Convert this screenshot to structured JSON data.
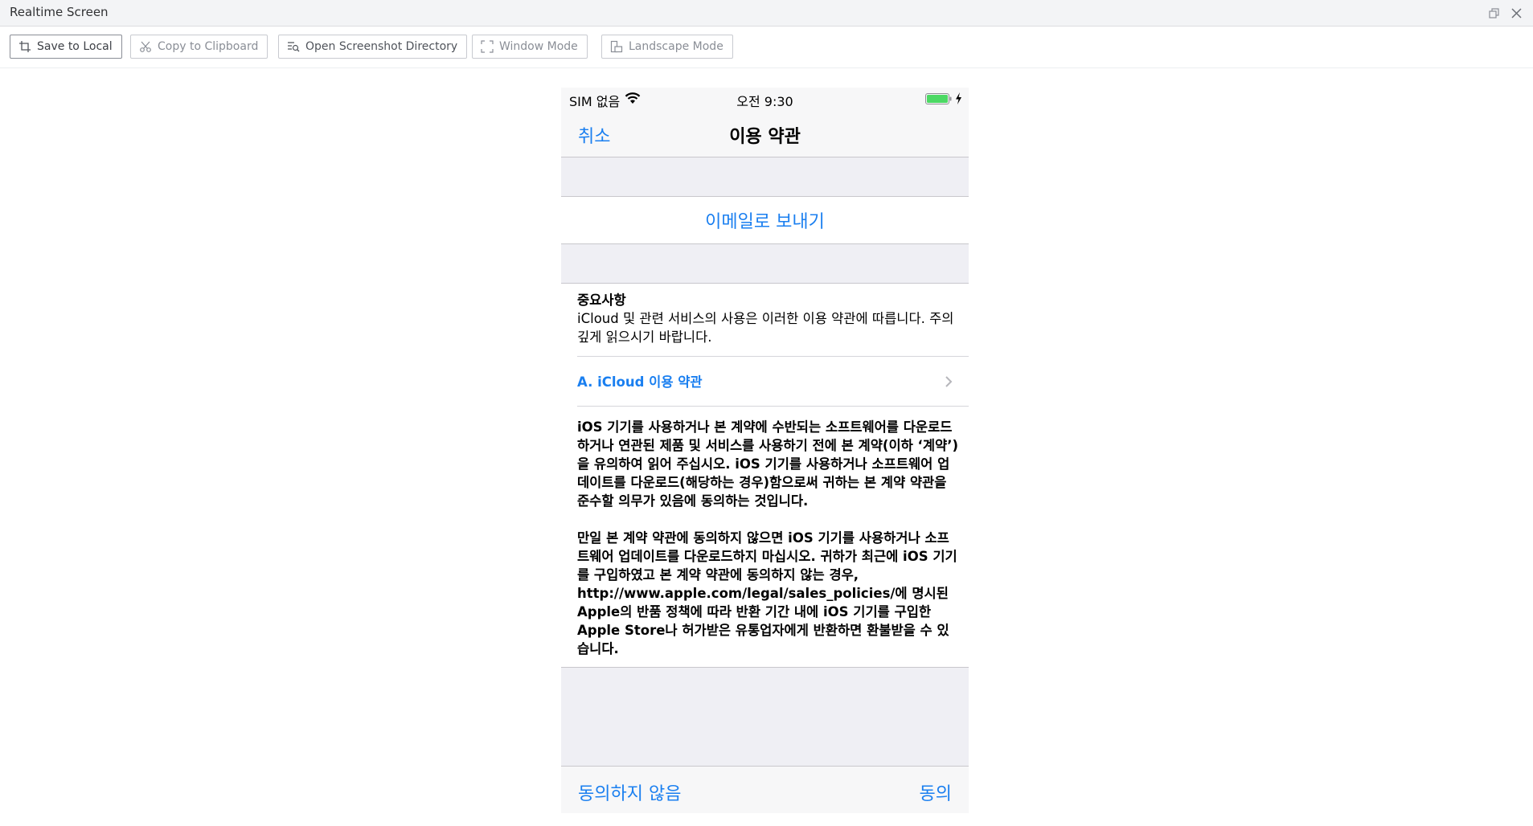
{
  "window": {
    "title": "Realtime Screen"
  },
  "toolbar": {
    "buttons": [
      {
        "label": "Save to Local",
        "icon": "crop-icon"
      },
      {
        "label": "Copy to Clipboard",
        "icon": "scissors-icon"
      },
      {
        "label": "Open Screenshot Directory",
        "icon": "folder-search-icon"
      },
      {
        "label": "Window Mode",
        "icon": "fullscreen-icon"
      },
      {
        "label": "Landscape Mode",
        "icon": "rotate-icon"
      }
    ]
  },
  "phone": {
    "status": {
      "carrier": "SIM 없음",
      "time": "오전 9:30",
      "battery_level": 1.0
    },
    "nav": {
      "cancel": "취소",
      "title": "이용 약관"
    },
    "email_button": "이메일로 보내기",
    "notice": {
      "heading": "중요사항",
      "body": "iCloud 및 관련 서비스의 사용은 이러한 이용 약관에 따릅니다. 주의 깊게 읽으시기 바랍니다."
    },
    "section_link": "A. iCloud 이용 약관",
    "legal_paragraphs": [
      "iOS 기기를 사용하거나 본 계약에 수반되는 소프트웨어를 다운로드 하거나 연관된 제품 및 서비스를 사용하기 전에 본 계약(이하 ‘계약’)을 유의하여 읽어 주십시오. iOS 기기를 사용하거나 소프트웨어 업데이트를 다운로드(해당하는 경우)함으로써 귀하는 본 계약 약관을 준수할 의무가 있음에 동의하는 것입니다.",
      "만일 본 계약 약관에 동의하지 않으면 iOS 기기를 사용하거나 소프트웨어 업데이트를 다운로드하지 마십시오. 귀하가 최근에 iOS 기기를 구입하였고 본 계약 약관에 동의하지 않는 경우, http://www.apple.com/legal/sales_policies/에 명시된 Apple의 반품 정책에 따라 반환 기간 내에 iOS 기기를 구입한 Apple Store나 허가받은 유통업자에게 반환하면 환불받을 수 있습니다."
    ],
    "bottom": {
      "disagree": "동의하지 않음",
      "agree": "동의"
    }
  },
  "colors": {
    "ios_blue": "#1a7ff0",
    "battery_green": "#4cd964",
    "group_background": "#efeff4"
  }
}
